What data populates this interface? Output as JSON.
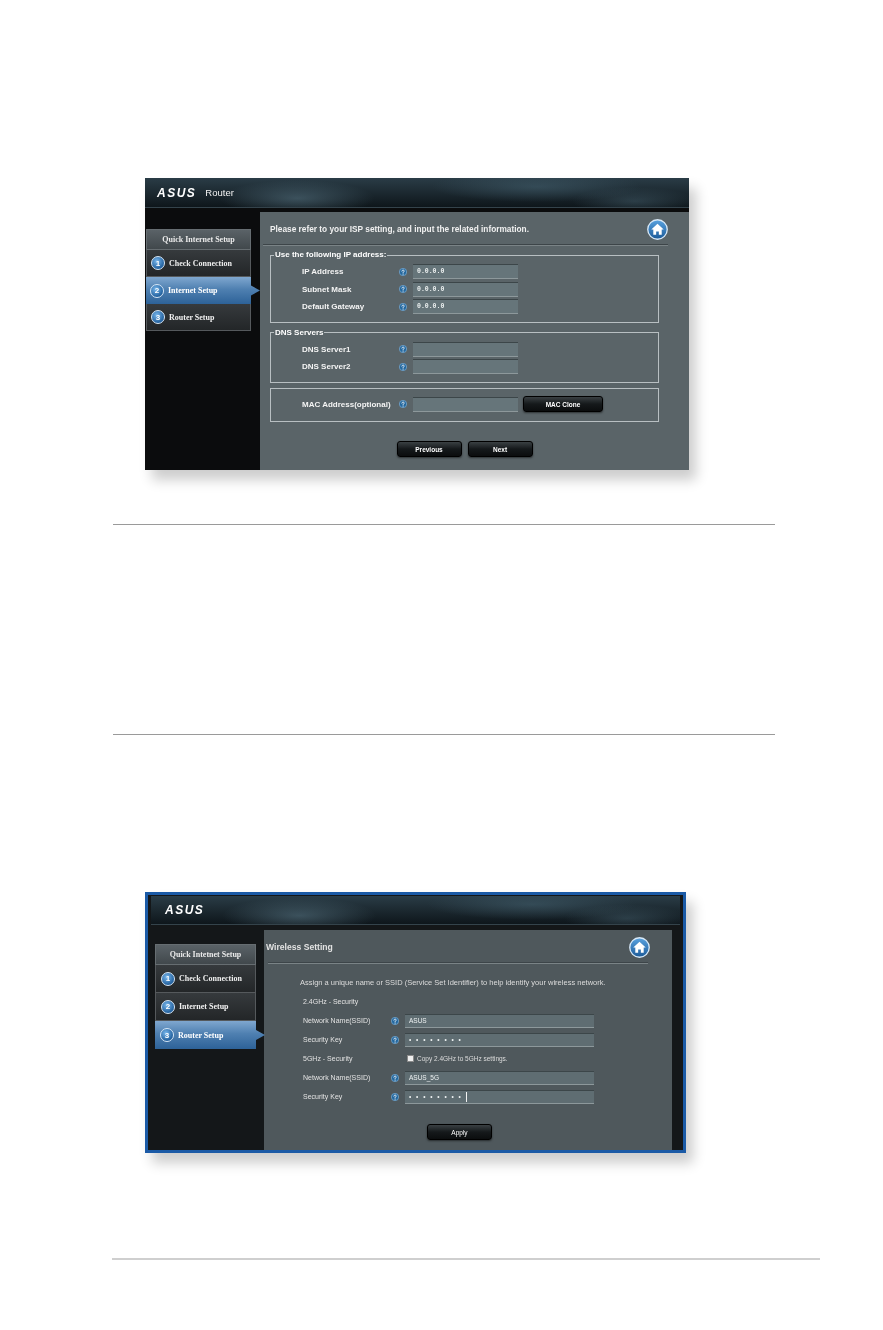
{
  "screens": [
    {
      "kind": "address",
      "framed": false,
      "header": {
        "logo": "ASUS",
        "product": "Router"
      },
      "sidebar": {
        "title": "Quick Internet Setup",
        "items": [
          {
            "number": "1",
            "label": "Check Connection",
            "selected": false
          },
          {
            "number": "2",
            "label": "Internet Setup",
            "selected": true
          },
          {
            "number": "3",
            "label": "Router Setup",
            "selected": false
          }
        ]
      },
      "panel": {
        "title": "Please refer to your ISP setting, and input the related information.",
        "groups": [
          {
            "legend": "Use the following IP address:",
            "rows": [
              {
                "label": "IP Address",
                "value": "0.0.0.0"
              },
              {
                "label": "Subnet Mask",
                "value": "0.0.0.0"
              },
              {
                "label": "Default Gateway",
                "value": "0.0.0.0"
              }
            ]
          },
          {
            "legend": "DNS Servers",
            "rows": [
              {
                "label": "DNS Server1"
              },
              {
                "label": "DNS Server2"
              }
            ]
          },
          {
            "rows": [
              {
                "label": "MAC Address(optional)",
                "button": "MAC Clone"
              }
            ]
          }
        ],
        "buttons": [
          "Previous",
          "Next"
        ]
      }
    },
    {
      "kind": "wireless",
      "framed": true,
      "header": {
        "logo": "ASUS"
      },
      "sidebar": {
        "title": "Quick Intetnet Setup",
        "items": [
          {
            "number": "1",
            "label": "Check Connection",
            "selected": false
          },
          {
            "number": "2",
            "label": "Internet Setup",
            "selected": false
          },
          {
            "number": "3",
            "label": "Router Setup",
            "selected": true
          }
        ]
      },
      "panel": {
        "title": "Wireless Setting",
        "description": "Assign a unique name or SSID (Service Set Identifier) to help identify your wireless network.",
        "rows": [
          {
            "kind": "heading",
            "label": "2.4GHz - Security"
          },
          {
            "kind": "field",
            "label": "Network Name(SSID)",
            "value": "ASUS",
            "focused": false
          },
          {
            "kind": "field",
            "label": "Security Key",
            "value": "• • • • • • • •",
            "focused": false
          },
          {
            "kind": "checkbox",
            "label": "5GHz - Security",
            "option": "Copy 2.4GHz to 5GHz settings.",
            "checked": false
          },
          {
            "kind": "field",
            "label": "Network Name(SSID)",
            "value": "ASUS_5G",
            "focused": false
          },
          {
            "kind": "field",
            "label": "Security Key",
            "value": "• • • • • • • •",
            "focused": true
          }
        ],
        "buttons": [
          "Apply"
        ]
      }
    }
  ]
}
